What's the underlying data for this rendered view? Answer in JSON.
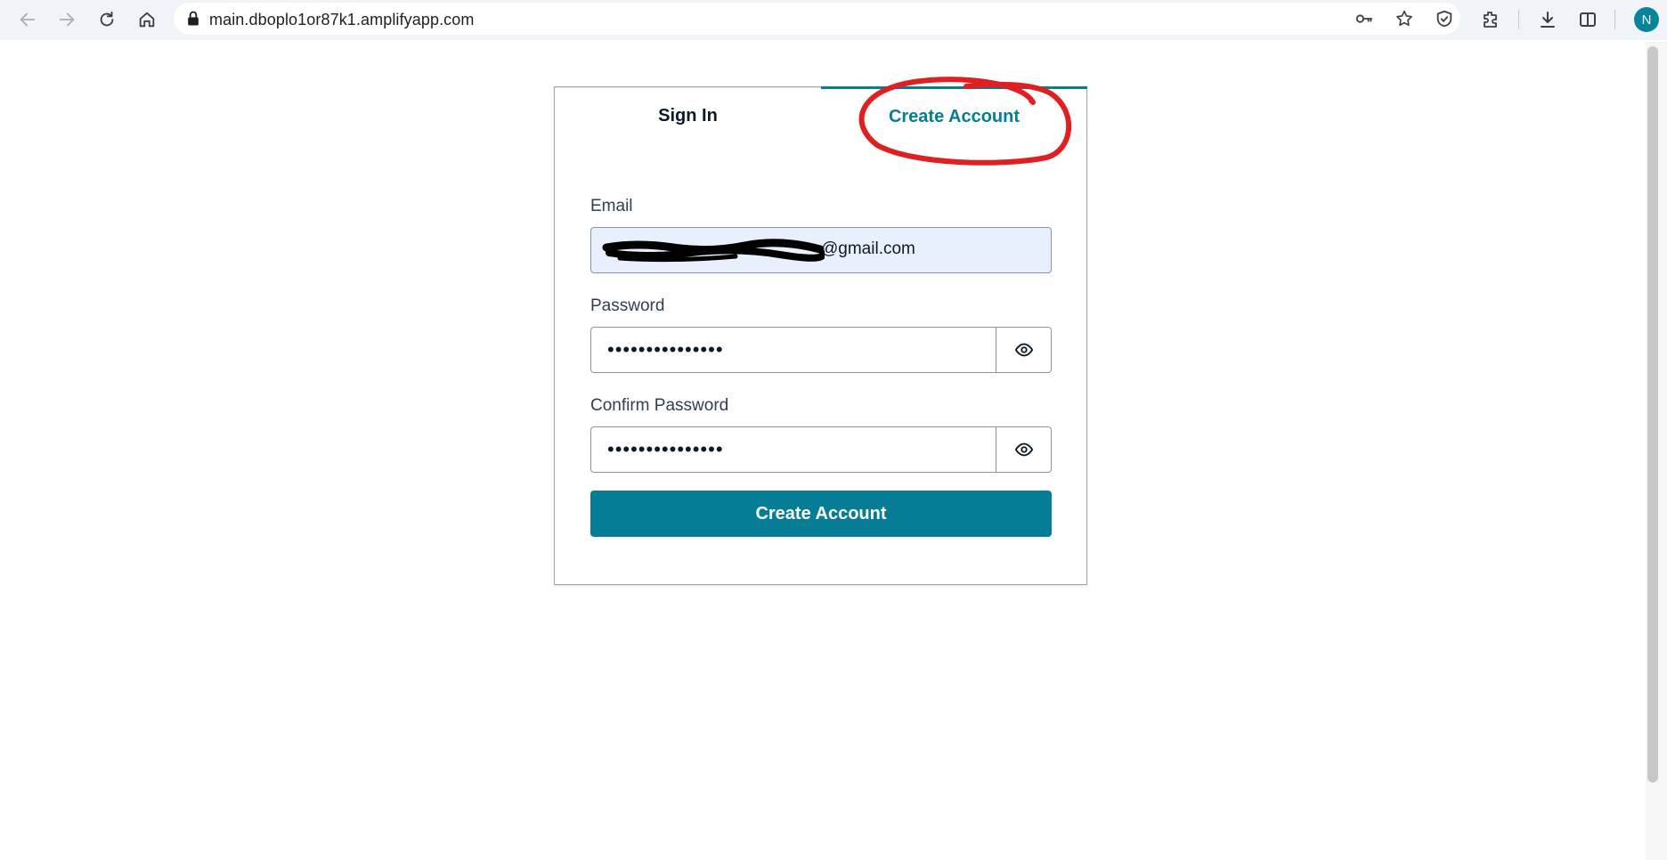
{
  "browser": {
    "url": "main.dboplo1or87k1.amplifyapp.com",
    "profile_initial": "N",
    "icons": [
      "back-icon",
      "forward-icon",
      "reload-icon",
      "home-icon",
      "lock-icon",
      "key-icon",
      "star-icon",
      "shield-icon",
      "extensions-icon",
      "download-icon",
      "sidepanel-icon"
    ]
  },
  "auth": {
    "tabs": {
      "sign_in": "Sign In",
      "create_account": "Create Account",
      "active": "create_account"
    },
    "email": {
      "label": "Email",
      "value_visible": "@gmail.com"
    },
    "password": {
      "label": "Password",
      "value": "•••••••••••••••"
    },
    "confirm_password": {
      "label": "Confirm Password",
      "value": "•••••••••••••••"
    },
    "submit_label": "Create Account"
  },
  "colors": {
    "accent": "#047d95",
    "annotation": "#e02020",
    "autofill": "#e8f0fe"
  }
}
